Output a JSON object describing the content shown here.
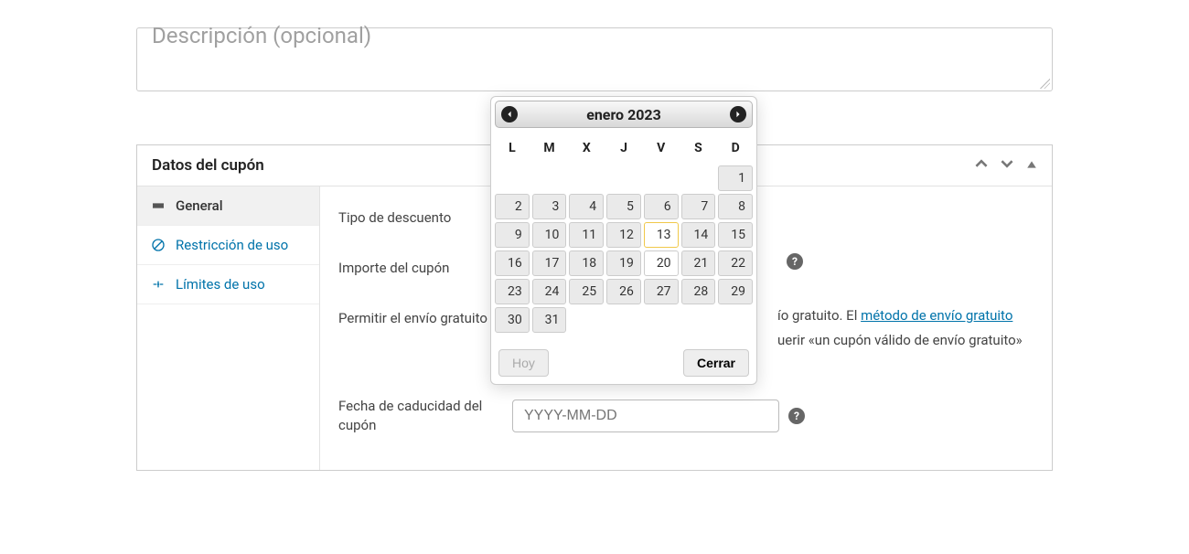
{
  "description": {
    "placeholder": "Descripción (opcional)"
  },
  "panel": {
    "title": "Datos del cupón",
    "tabs": [
      {
        "label": "General",
        "icon": "ticket-icon",
        "active": true
      },
      {
        "label": "Restricción de uso",
        "icon": "restriction-icon",
        "active": false
      },
      {
        "label": "Límites de uso",
        "icon": "limits-icon",
        "active": false
      }
    ],
    "fields": {
      "discount_type_label": "Tipo de descuento",
      "amount_label": "Importe del cupón",
      "free_shipping_label": "Permitir el envío gratuito",
      "free_shipping_text_trail": "ío gratuito. El ",
      "free_shipping_link": "método de envío gratuito",
      "free_shipping_text2": "uerir «un cupón válido de envío gratuito»",
      "expiry_label": "Fecha de caducidad del cupón",
      "expiry_placeholder": "YYYY-MM-DD"
    }
  },
  "datepicker": {
    "title": "enero 2023",
    "dow": [
      "L",
      "M",
      "X",
      "J",
      "V",
      "S",
      "D"
    ],
    "leading_blanks": 6,
    "days_in_month": 31,
    "today": 13,
    "selected": 20,
    "today_label": "Hoy",
    "close_label": "Cerrar"
  }
}
